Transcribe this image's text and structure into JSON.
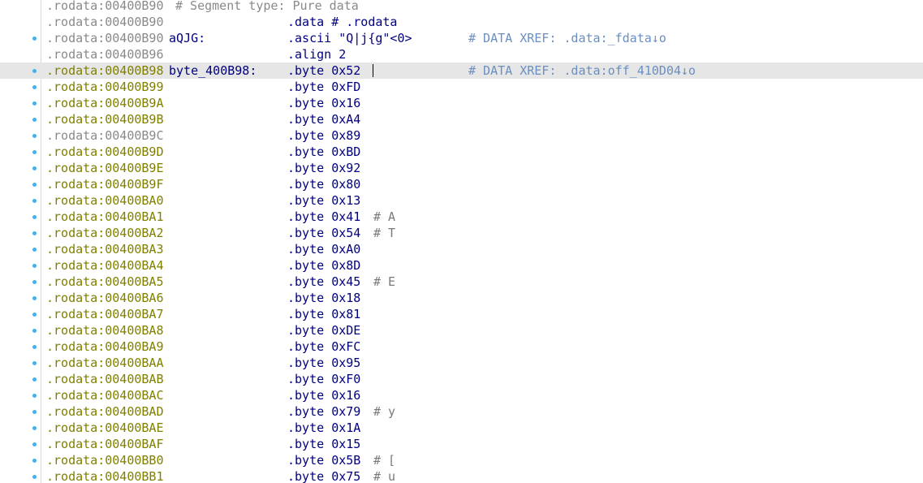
{
  "rows": [
    {
      "addr": ".rodata:00400B90",
      "top_comment": "# Segment type: Pure data",
      "gray": true,
      "dot": false
    },
    {
      "addr": ".rodata:00400B90",
      "mnemonic": ".data",
      "operand": "# .rodata",
      "gray": true,
      "dot": false
    },
    {
      "addr": ".rodata:00400B90",
      "label": "aQJG:",
      "mnemonic": ".ascii",
      "operand": "\"Q|j{g\"<0>",
      "xref": "# DATA XREF: .data:_fdata↓o",
      "gray": true,
      "dot": true
    },
    {
      "addr": ".rodata:00400B96",
      "mnemonic": ".align",
      "operand": "2",
      "gray": true,
      "dot": false
    },
    {
      "addr": ".rodata:00400B98",
      "label": "byte_400B98:",
      "mnemonic": ".byte",
      "operand": "0x52",
      "xref": "# DATA XREF: .data:off_410D04↓o",
      "gray": false,
      "dot": true,
      "highlight": true
    },
    {
      "addr": ".rodata:00400B99",
      "mnemonic": ".byte",
      "operand": "0xFD",
      "dot": true
    },
    {
      "addr": ".rodata:00400B9A",
      "mnemonic": ".byte",
      "operand": "0x16",
      "dot": true
    },
    {
      "addr": ".rodata:00400B9B",
      "mnemonic": ".byte",
      "operand": "0xA4",
      "dot": true
    },
    {
      "addr": ".rodata:00400B9C",
      "mnemonic": ".byte",
      "operand": "0x89",
      "dot": true,
      "gray": true
    },
    {
      "addr": ".rodata:00400B9D",
      "mnemonic": ".byte",
      "operand": "0xBD",
      "dot": true
    },
    {
      "addr": ".rodata:00400B9E",
      "mnemonic": ".byte",
      "operand": "0x92",
      "dot": true
    },
    {
      "addr": ".rodata:00400B9F",
      "mnemonic": ".byte",
      "operand": "0x80",
      "dot": true
    },
    {
      "addr": ".rodata:00400BA0",
      "mnemonic": ".byte",
      "operand": "0x13",
      "dot": true
    },
    {
      "addr": ".rodata:00400BA1",
      "mnemonic": ".byte",
      "operand": "0x41",
      "comment": "# A",
      "dot": true
    },
    {
      "addr": ".rodata:00400BA2",
      "mnemonic": ".byte",
      "operand": "0x54",
      "comment": "# T",
      "dot": true
    },
    {
      "addr": ".rodata:00400BA3",
      "mnemonic": ".byte",
      "operand": "0xA0",
      "dot": true
    },
    {
      "addr": ".rodata:00400BA4",
      "mnemonic": ".byte",
      "operand": "0x8D",
      "dot": true
    },
    {
      "addr": ".rodata:00400BA5",
      "mnemonic": ".byte",
      "operand": "0x45",
      "comment": "# E",
      "dot": true
    },
    {
      "addr": ".rodata:00400BA6",
      "mnemonic": ".byte",
      "operand": "0x18",
      "dot": true
    },
    {
      "addr": ".rodata:00400BA7",
      "mnemonic": ".byte",
      "operand": "0x81",
      "dot": true
    },
    {
      "addr": ".rodata:00400BA8",
      "mnemonic": ".byte",
      "operand": "0xDE",
      "dot": true
    },
    {
      "addr": ".rodata:00400BA9",
      "mnemonic": ".byte",
      "operand": "0xFC",
      "dot": true
    },
    {
      "addr": ".rodata:00400BAA",
      "mnemonic": ".byte",
      "operand": "0x95",
      "dot": true
    },
    {
      "addr": ".rodata:00400BAB",
      "mnemonic": ".byte",
      "operand": "0xF0",
      "dot": true
    },
    {
      "addr": ".rodata:00400BAC",
      "mnemonic": ".byte",
      "operand": "0x16",
      "dot": true
    },
    {
      "addr": ".rodata:00400BAD",
      "mnemonic": ".byte",
      "operand": "0x79",
      "comment": "# y",
      "dot": true
    },
    {
      "addr": ".rodata:00400BAE",
      "mnemonic": ".byte",
      "operand": "0x1A",
      "dot": true
    },
    {
      "addr": ".rodata:00400BAF",
      "mnemonic": ".byte",
      "operand": "0x15",
      "dot": true
    },
    {
      "addr": ".rodata:00400BB0",
      "mnemonic": ".byte",
      "operand": "0x5B",
      "comment": "# [",
      "dot": true
    },
    {
      "addr": ".rodata:00400BB1",
      "mnemonic": ".byte",
      "operand": "0x75",
      "comment": "# u",
      "dot": true
    }
  ],
  "colors": {
    "address": "#808000",
    "address_gray": "#8a8a8a",
    "code": "#00007f",
    "comment": "#7a7a7a",
    "xref": "#6a8fc0",
    "highlight": "#e6e6e6",
    "breakpoint_dot": "#46aee8"
  }
}
